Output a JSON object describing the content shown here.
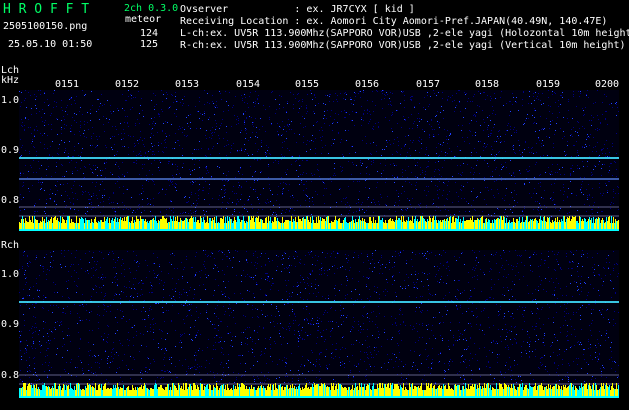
{
  "app": {
    "title": "H R O F F T",
    "version": "2ch 0.3.0",
    "filename": "2505100150.png",
    "meteor_label": "meteor",
    "count_l": "124",
    "count_r": "125",
    "datetime": "25.05.10 01:50"
  },
  "header": {
    "observer": "Ovserver           : ex. JR7CYX [ kid ]",
    "location": "Receiving Location : ex. Aomori City Aomori-Pref.JAPAN(40.49N, 140.47E)",
    "lch": "L-ch:ex. UV5R 113.900Mhz(SAPPORO VOR)USB ,2-ele yagi (Holozontal 10m height)",
    "rch": "R-ch:ex. UV5R 113.900Mhz(SAPPORO VOR)USB ,2-ele yagi (Vertical 10m height)"
  },
  "axes": {
    "lch_label": "Lch",
    "khz_label": "kHz",
    "rch_label": "Rch",
    "time_ticks": [
      "0151",
      "0152",
      "0153",
      "0154",
      "0155",
      "0156",
      "0157",
      "0158",
      "0159",
      "0200"
    ],
    "freq_ticks": [
      "1.0",
      "0.9",
      "0.8"
    ]
  },
  "colors": {
    "background": "#000000",
    "noise_dark": "#000080",
    "noise_light": "#2040ff",
    "carrier": "#40e0ff",
    "power_yellow": "#ffff00",
    "power_cyan": "#00ffff",
    "title_green": "#00ff66"
  }
}
